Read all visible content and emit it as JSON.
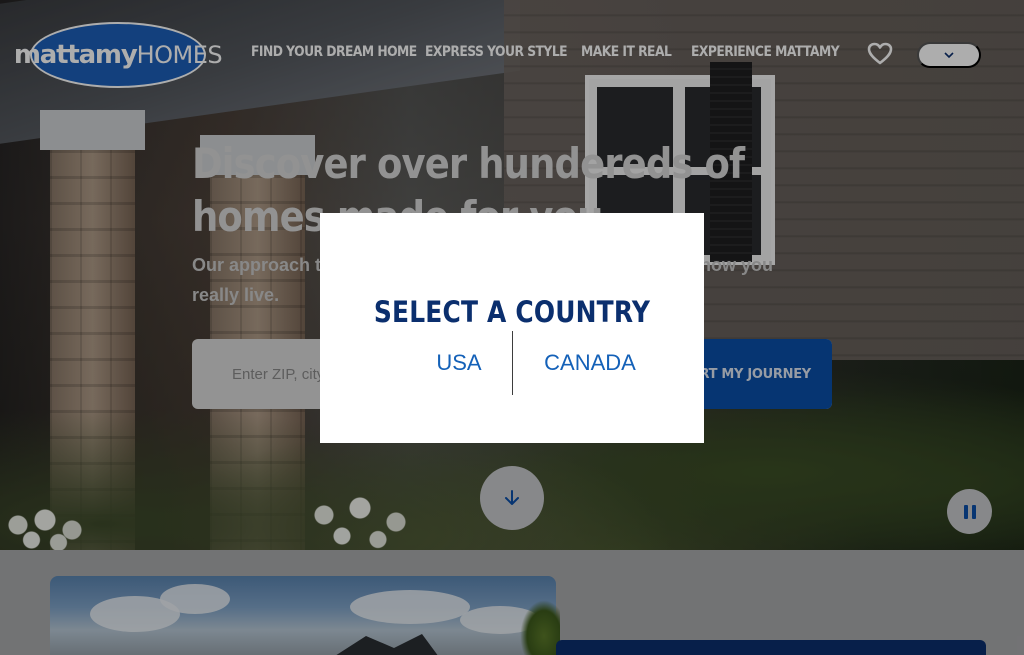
{
  "brand": {
    "logo_main": "mattamy",
    "logo_sub": "HOMES",
    "primary_color": "#1c5fb8",
    "navy_color": "#0b2f6e"
  },
  "header": {
    "nav": [
      {
        "label": "FIND YOUR DREAM HOME"
      },
      {
        "label": "EXPRESS YOUR STYLE"
      },
      {
        "label": "MAKE IT REAL"
      },
      {
        "label": "EXPERIENCE MATTAMY"
      }
    ],
    "favorites_icon": "heart-icon",
    "country_selector_icon": "chevron-down-icon"
  },
  "hero": {
    "title": "Discover over hundereds of homes made for you",
    "subtitle": "Our approach to building homes starts with understanding how you really live.",
    "search": {
      "placeholder": "Enter ZIP, city",
      "button_label": "START MY JOURNEY"
    },
    "scroll_icon": "arrow-down-icon",
    "pause_icon": "pause-icon"
  },
  "modal": {
    "title": "SELECT A COUNTRY",
    "options": [
      {
        "label": "USA"
      },
      {
        "label": "CANADA"
      }
    ]
  }
}
